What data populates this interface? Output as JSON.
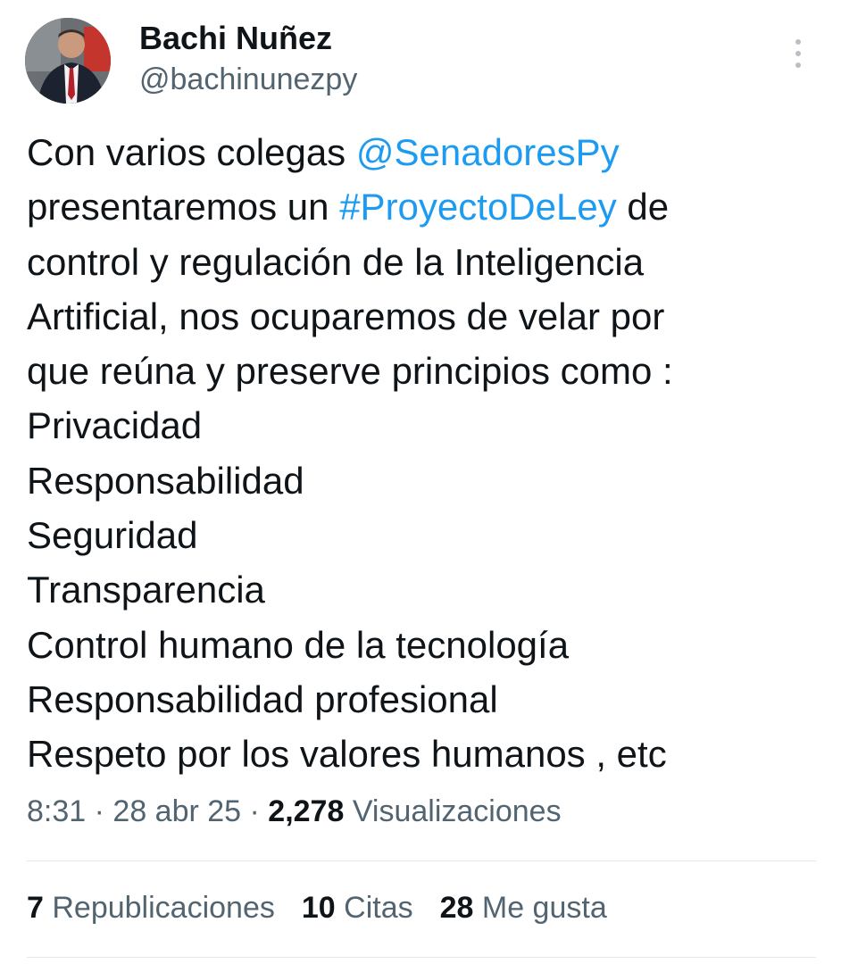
{
  "author": {
    "name": "Bachi Nuñez",
    "handle": "@bachinunezpy"
  },
  "tweet": {
    "lines": [
      [
        {
          "text": "Con varios colegas "
        },
        {
          "text": "@SenadoresPy",
          "link": true
        }
      ],
      [
        {
          "text": "presentaremos un "
        },
        {
          "text": "#ProyectoDeLey",
          "link": true
        },
        {
          "text": " de"
        }
      ],
      [
        {
          "text": "control y regulación de la Inteligencia"
        }
      ],
      [
        {
          "text": "Artificial, nos ocuparemos de velar por"
        }
      ],
      [
        {
          "text": "que reúna y preserve principios como :"
        }
      ],
      [
        {
          "text": "Privacidad"
        }
      ],
      [
        {
          "text": "Responsabilidad"
        }
      ],
      [
        {
          "text": "Seguridad"
        }
      ],
      [
        {
          "text": "Transparencia"
        }
      ],
      [
        {
          "text": "Control humano de la tecnología"
        }
      ],
      [
        {
          "text": "Responsabilidad profesional"
        }
      ],
      [
        {
          "text": "Respeto por los valores humanos , etc"
        }
      ]
    ]
  },
  "meta": {
    "time": "8:31",
    "separator": " · ",
    "date": "28 abr 25",
    "views_count": "2,278",
    "views_label": " Visualizaciones"
  },
  "stats": {
    "reposts_count": "7",
    "reposts_label": " Republicaciones",
    "quotes_count": "10",
    "quotes_label": " Citas",
    "likes_count": "28",
    "likes_label": " Me gusta"
  },
  "colors": {
    "link": "#1d9bf0",
    "text": "#0f1419",
    "secondary": "#536471"
  },
  "icons": {
    "more": "more-vertical-icon"
  }
}
